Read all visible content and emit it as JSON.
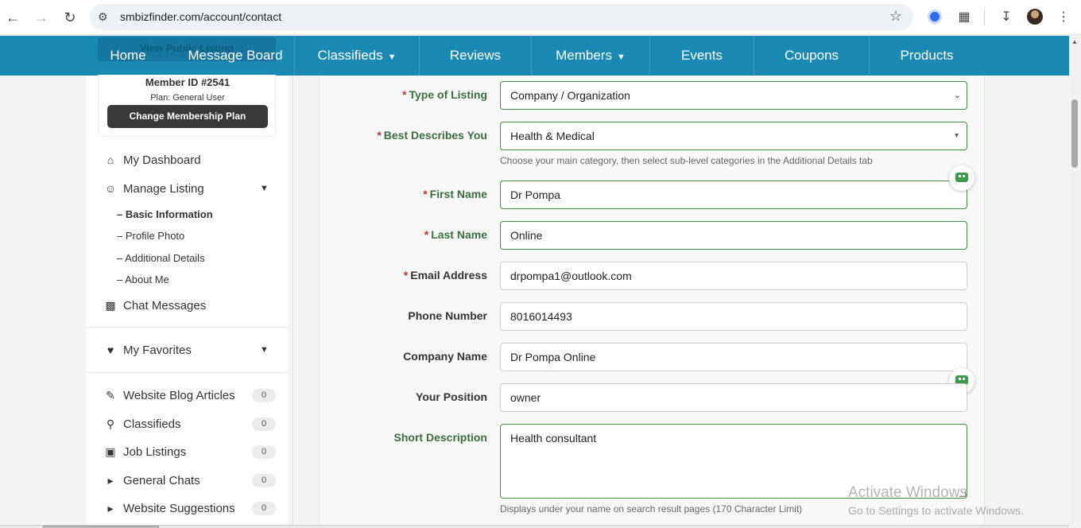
{
  "browser": {
    "url": "smbizfinder.com/account/contact"
  },
  "nav": {
    "ghost_button": "View Public Listing",
    "items": [
      {
        "label": "Home",
        "dropdown": false
      },
      {
        "label": "Message Board",
        "dropdown": false
      },
      {
        "label": "Classifieds",
        "dropdown": true
      },
      {
        "label": "Reviews",
        "dropdown": false
      },
      {
        "label": "Members",
        "dropdown": true
      },
      {
        "label": "Events",
        "dropdown": false
      },
      {
        "label": "Coupons",
        "dropdown": false
      },
      {
        "label": "Products",
        "dropdown": false
      }
    ]
  },
  "member": {
    "id_label": "Member ID #2541",
    "plan_label": "Plan: General User",
    "change_plan_button": "Change Membership Plan"
  },
  "sidebar": {
    "dashboard": "My Dashboard",
    "manage_listing": "Manage Listing",
    "sub_items": [
      "– Basic Information",
      "– Profile Photo",
      "– Additional Details",
      "– About Me"
    ],
    "chat_messages": "Chat Messages",
    "favorites": "My Favorites",
    "content": [
      {
        "label": "Website Blog Articles",
        "count": "0"
      },
      {
        "label": "Classifieds",
        "count": "0"
      },
      {
        "label": "Job Listings",
        "count": "0"
      },
      {
        "label": "General Chats",
        "count": "0"
      },
      {
        "label": "Website Suggestions",
        "count": "0"
      }
    ]
  },
  "form": {
    "listing_type": {
      "label": "Type of Listing",
      "value": "Company / Organization"
    },
    "category": {
      "label": "Best Describes You",
      "value": "Health & Medical",
      "help": "Choose your main category, then select sub-level categories in the Additional Details tab"
    },
    "first_name": {
      "label": "First Name",
      "value": "Dr Pompa"
    },
    "last_name": {
      "label": "Last Name",
      "value": "Online"
    },
    "email": {
      "label": "Email Address",
      "value": "drpompa1@outlook.com"
    },
    "phone": {
      "label": "Phone Number",
      "value": "8016014493"
    },
    "company": {
      "label": "Company Name",
      "value": "Dr Pompa Online"
    },
    "position": {
      "label": "Your Position",
      "value": "owner"
    },
    "description": {
      "label": "Short Description",
      "value": "Health consultant",
      "help": "Displays under your name on search result pages (170 Character Limit)"
    }
  },
  "watermark": {
    "line1": "Activate Windows",
    "line2": "Go to Settings to activate Windows."
  },
  "colors": {
    "nav_bg": "#1a8ab5",
    "valid_border": "#4a8a4c",
    "required": "#c0392b"
  }
}
